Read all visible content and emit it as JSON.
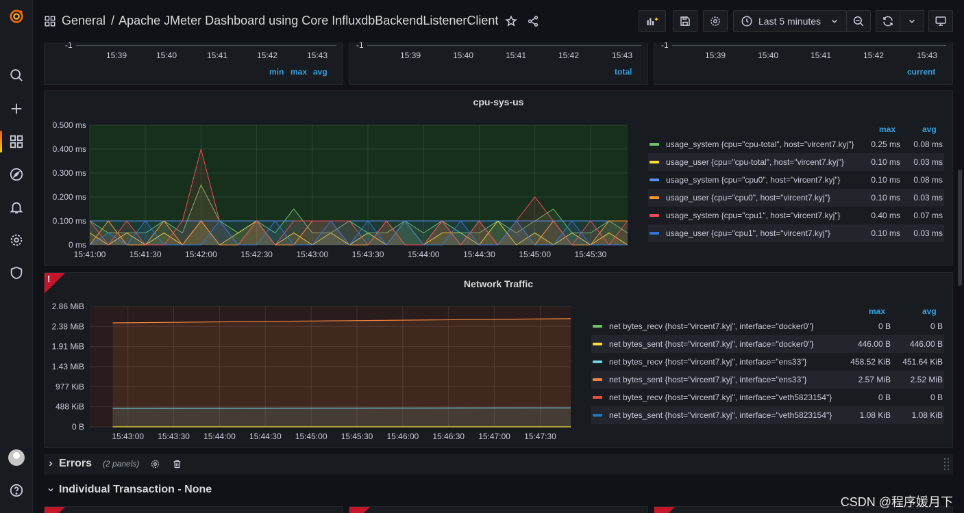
{
  "breadcrumb": {
    "folder": "General",
    "separator": "/",
    "dashboard": "Apache JMeter Dashboard using Core InfluxdbBackendListenerClient"
  },
  "toolbar": {
    "time_range": "Last 5 minutes"
  },
  "top_panels": [
    {
      "y_tick": "-1",
      "times": [
        "15:39",
        "15:40",
        "15:41",
        "15:42",
        "15:43"
      ],
      "legend_headers": [
        "min",
        "max",
        "avg"
      ]
    },
    {
      "y_tick": "-1",
      "times": [
        "15:39",
        "15:40",
        "15:41",
        "15:42",
        "15:43"
      ],
      "legend_headers": [
        "total"
      ]
    },
    {
      "y_tick": "-1",
      "times": [
        "15:39",
        "15:40",
        "15:41",
        "15:42",
        "15:43"
      ],
      "legend_headers": [
        "current"
      ]
    }
  ],
  "cpu_panel": {
    "title": "cpu-sys-us",
    "legend_headers": [
      "max",
      "avg"
    ],
    "legend": [
      {
        "name": "usage_system {cpu=\"cpu-total\", host=\"vircent7.kyj\"}",
        "max": "0.25 ms",
        "avg": "0.08 ms",
        "color": "#73bf69"
      },
      {
        "name": "usage_user {cpu=\"cpu-total\", host=\"vircent7.kyj\"}",
        "max": "0.10 ms",
        "avg": "0.03 ms",
        "color": "#fade2a"
      },
      {
        "name": "usage_system {cpu=\"cpu0\", host=\"vircent7.kyj\"}",
        "max": "0.10 ms",
        "avg": "0.08 ms",
        "color": "#5794f2"
      },
      {
        "name": "usage_user {cpu=\"cpu0\", host=\"vircent7.kyj\"}",
        "max": "0.10 ms",
        "avg": "0.03 ms",
        "color": "#ff9830"
      },
      {
        "name": "usage_system {cpu=\"cpu1\", host=\"vircent7.kyj\"}",
        "max": "0.40 ms",
        "avg": "0.07 ms",
        "color": "#f2495c"
      },
      {
        "name": "usage_user {cpu=\"cpu1\", host=\"vircent7.kyj\"}",
        "max": "0.10 ms",
        "avg": "0.03 ms",
        "color": "#3274d9"
      }
    ]
  },
  "network_panel": {
    "title": "Network Traffic",
    "warning_glyph": "!",
    "legend_headers": [
      "max",
      "avg"
    ],
    "legend": [
      {
        "name": "net bytes_recv {host=\"vircent7.kyj\", interface=\"docker0\"}",
        "max": "0 B",
        "avg": "0 B",
        "color": "#73bf69"
      },
      {
        "name": "net bytes_sent {host=\"vircent7.kyj\", interface=\"docker0\"}",
        "max": "446.00 B",
        "avg": "446.00 B",
        "color": "#fade2a"
      },
      {
        "name": "net bytes_recv {host=\"vircent7.kyj\", interface=\"ens33\"}",
        "max": "458.52 KiB",
        "avg": "451.64 KiB",
        "color": "#6ed0e0"
      },
      {
        "name": "net bytes_sent {host=\"vircent7.kyj\", interface=\"ens33\"}",
        "max": "2.57 MiB",
        "avg": "2.52 MiB",
        "color": "#ef843c"
      },
      {
        "name": "net bytes_recv {host=\"vircent7.kyj\", interface=\"veth5823154\"}",
        "max": "0 B",
        "avg": "0 B",
        "color": "#e24d42"
      },
      {
        "name": "net bytes_sent {host=\"vircent7.kyj\", interface=\"veth5823154\"}",
        "max": "1.08 KiB",
        "avg": "1.08 KiB",
        "color": "#1f78c1"
      }
    ]
  },
  "rows": {
    "errors": {
      "title": "Errors",
      "count": "(2 panels)"
    },
    "transaction": {
      "title": "Individual Transaction - None"
    }
  },
  "watermark": "CSDN @程序媛月下",
  "chart_data": [
    {
      "type": "line",
      "title": "cpu-sys-us",
      "x": [
        "15:41:00",
        "15:41:10",
        "15:41:20",
        "15:41:30",
        "15:41:40",
        "15:41:50",
        "15:42:00",
        "15:42:10",
        "15:42:20",
        "15:42:30",
        "15:42:40",
        "15:42:50",
        "15:43:00",
        "15:43:10",
        "15:43:20",
        "15:43:30",
        "15:43:40",
        "15:43:50",
        "15:44:00",
        "15:44:10",
        "15:44:20",
        "15:44:30",
        "15:44:40",
        "15:44:50",
        "15:45:00",
        "15:45:10",
        "15:45:20",
        "15:45:30",
        "15:45:40",
        "15:45:50"
      ],
      "x_ticks": [
        "15:41:00",
        "15:41:30",
        "15:42:00",
        "15:42:30",
        "15:43:00",
        "15:43:30",
        "15:44:00",
        "15:44:30",
        "15:45:00",
        "15:45:30"
      ],
      "y_ticks": [
        "0 ms",
        "0.100 ms",
        "0.200 ms",
        "0.300 ms",
        "0.400 ms",
        "0.500 ms"
      ],
      "ylim": [
        0,
        0.5
      ],
      "series": [
        {
          "name": "usage_system {cpu=\"cpu-total\", host=\"vircent7.kyj\"}",
          "values": [
            0.1,
            0.05,
            0.05,
            0.05,
            0.1,
            0.05,
            0.25,
            0.1,
            0.05,
            0.1,
            0.05,
            0.15,
            0.05,
            0.05,
            0.1,
            0.05,
            0.05,
            0.1,
            0.05,
            0.1,
            0.05,
            0.05,
            0.1,
            0.05,
            0.1,
            0.15,
            0.05,
            0.05,
            0.1,
            0.05
          ]
        },
        {
          "name": "usage_user {cpu=\"cpu-total\", host=\"vircent7.kyj\"}",
          "values": [
            0.05,
            0.0,
            0.05,
            0.0,
            0.05,
            0.0,
            0.1,
            0.0,
            0.05,
            0.1,
            0.0,
            0.05,
            0.0,
            0.05,
            0.0,
            0.05,
            0.0,
            0.1,
            0.0,
            0.05,
            0.05,
            0.0,
            0.1,
            0.0,
            0.05,
            0.0,
            0.05,
            0.0,
            0.05,
            0.0
          ]
        },
        {
          "name": "usage_system {cpu=\"cpu0\", host=\"vircent7.kyj\"}",
          "values": [
            0.1,
            0.1,
            0.1,
            0.1,
            0.1,
            0.1,
            0.1,
            0.1,
            0.1,
            0.1,
            0.1,
            0.1,
            0.1,
            0.1,
            0.1,
            0.1,
            0.1,
            0.1,
            0.1,
            0.1,
            0.1,
            0.1,
            0.1,
            0.1,
            0.1,
            0.1,
            0.1,
            0.1,
            0.1,
            0.1
          ]
        },
        {
          "name": "usage_user {cpu=\"cpu0\", host=\"vircent7.kyj\"}",
          "values": [
            0.0,
            0.1,
            0.0,
            0.0,
            0.1,
            0.0,
            0.1,
            0.0,
            0.0,
            0.1,
            0.0,
            0.0,
            0.1,
            0.1,
            0.0,
            0.0,
            0.1,
            0.0,
            0.0,
            0.1,
            0.0,
            0.1,
            0.0,
            0.1,
            0.0,
            0.1,
            0.0,
            0.0,
            0.1,
            0.1
          ]
        },
        {
          "name": "usage_system {cpu=\"cpu1\", host=\"vircent7.kyj\"}",
          "values": [
            0.1,
            0.0,
            0.1,
            0.0,
            0.0,
            0.1,
            0.4,
            0.1,
            0.0,
            0.1,
            0.0,
            0.1,
            0.1,
            0.1,
            0.1,
            0.0,
            0.1,
            0.0,
            0.0,
            0.1,
            0.0,
            0.1,
            0.0,
            0.1,
            0.2,
            0.1,
            0.0,
            0.1,
            0.0,
            0.1
          ]
        },
        {
          "name": "usage_user {cpu=\"cpu1\", host=\"vircent7.kyj\"}",
          "values": [
            0.0,
            0.05,
            0.0,
            0.1,
            0.0,
            0.0,
            0.0,
            0.1,
            0.0,
            0.0,
            0.1,
            0.0,
            0.0,
            0.1,
            0.0,
            0.1,
            0.0,
            0.1,
            0.0,
            0.0,
            0.1,
            0.0,
            0.0,
            0.1,
            0.0,
            0.0,
            0.1,
            0.0,
            0.0,
            0.0
          ]
        }
      ]
    },
    {
      "type": "area",
      "title": "Network Traffic",
      "x_ticks": [
        "15:43:00",
        "15:43:30",
        "15:44:00",
        "15:44:30",
        "15:45:00",
        "15:45:30",
        "15:46:00",
        "15:46:30",
        "15:47:00",
        "15:47:30"
      ],
      "y_ticks": [
        "0 B",
        "488 KiB",
        "977 KiB",
        "1.43 MiB",
        "1.91 MiB",
        "2.38 MiB",
        "2.86 MiB"
      ],
      "y_unit": "MiB",
      "ylim": [
        0,
        2.86
      ],
      "x": [
        "15:42:50",
        "15:47:50"
      ],
      "series": [
        {
          "name": "net bytes_sent {host=\"vircent7.kyj\", interface=\"ens33\"}",
          "values": [
            2.47,
            2.57
          ]
        },
        {
          "name": "net bytes_recv {host=\"vircent7.kyj\", interface=\"ens33\"}",
          "values": [
            0.44,
            0.45
          ]
        },
        {
          "name": "net bytes_sent {host=\"vircent7.kyj\", interface=\"veth5823154\"}",
          "values": [
            0.001,
            0.001
          ]
        },
        {
          "name": "net bytes_sent {host=\"vircent7.kyj\", interface=\"docker0\"}",
          "values": [
            0.0004,
            0.0004
          ]
        }
      ]
    }
  ]
}
